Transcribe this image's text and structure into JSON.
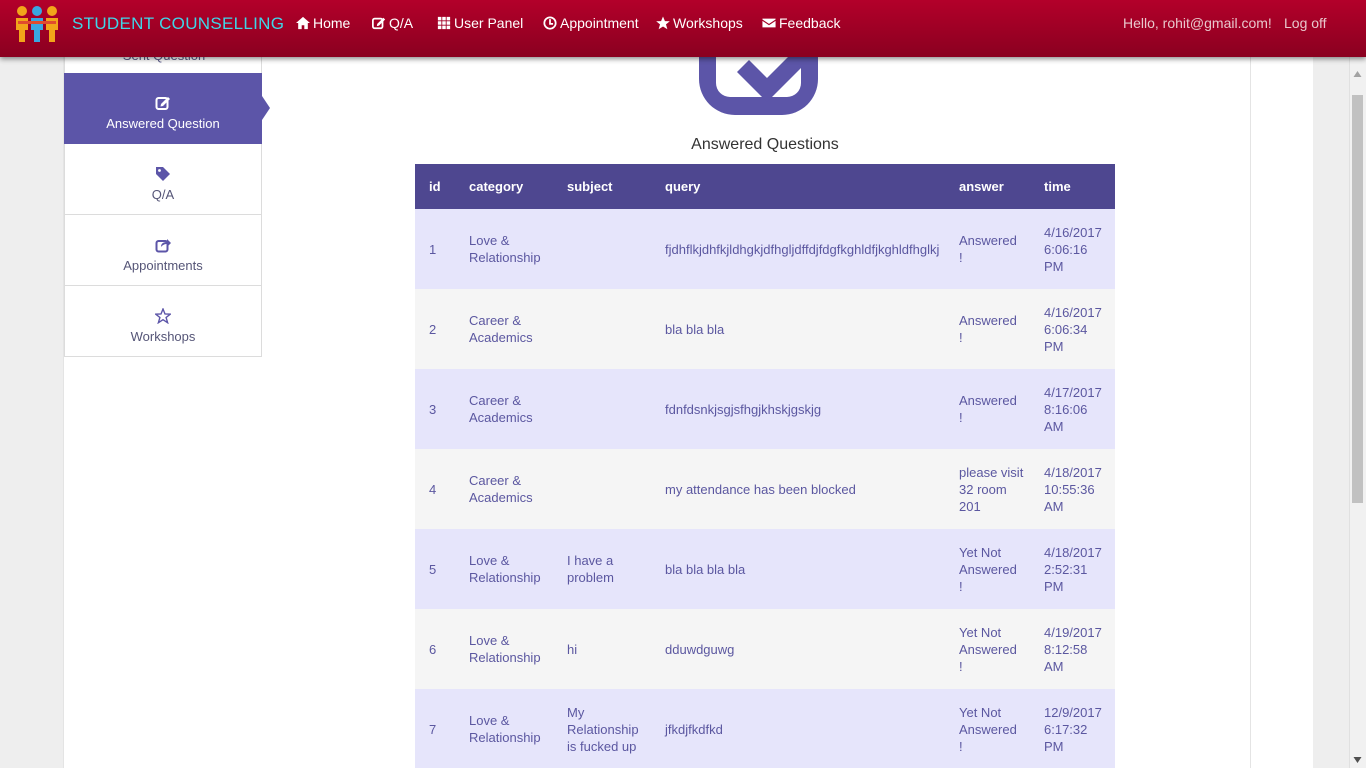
{
  "brand": {
    "title": "STUDENT COUNSELLING"
  },
  "nav": {
    "items": [
      {
        "label": "Home",
        "icon": "home-icon"
      },
      {
        "label": "Q/A",
        "icon": "edit-icon"
      },
      {
        "label": "User Panel",
        "icon": "grid-icon"
      },
      {
        "label": "Appointment",
        "icon": "clock-icon"
      },
      {
        "label": "Workshops",
        "icon": "star-icon"
      },
      {
        "label": "Feedback",
        "icon": "envelope-icon"
      }
    ],
    "greeting": "Hello, rohit@gmail.com!",
    "logoff": "Log off"
  },
  "sidebar": {
    "partial_label": "Sent Question",
    "items": [
      {
        "label": "Answered Question",
        "icon": "edit-icon",
        "active": true
      },
      {
        "label": "Q/A",
        "icon": "tag-icon"
      },
      {
        "label": "Appointments",
        "icon": "share-icon"
      },
      {
        "label": "Workshops",
        "icon": "star-outline-icon"
      }
    ]
  },
  "main": {
    "title": "Answered Questions",
    "columns": [
      "id",
      "category",
      "subject",
      "query",
      "answer",
      "time"
    ],
    "rows": [
      {
        "id": "1",
        "category": "Love & Relationship",
        "subject": "",
        "query": "fjdhflkjdhfkjldhgkjdfhgljdffdjfdgfkghldfjkghldfhglkj",
        "answer": "Answered !",
        "time": "4/16/2017 6:06:16 PM"
      },
      {
        "id": "2",
        "category": "Career & Academics",
        "subject": "",
        "query": "bla bla bla",
        "answer": "Answered !",
        "time": "4/16/2017 6:06:34 PM"
      },
      {
        "id": "3",
        "category": "Career & Academics",
        "subject": "",
        "query": "fdnfdsnkjsgjsfhgjkhskjgskjg",
        "answer": "Answered !",
        "time": "4/17/2017 8:16:06 AM"
      },
      {
        "id": "4",
        "category": "Career & Academics",
        "subject": "",
        "query": "my attendance has been blocked",
        "answer": "please visit 32 room 201",
        "time": "4/18/2017 10:55:36 AM"
      },
      {
        "id": "5",
        "category": "Love & Relationship",
        "subject": "I have a problem",
        "query": "bla bla bla bla",
        "answer": "Yet Not Answered !",
        "time": "4/18/2017 2:52:31 PM"
      },
      {
        "id": "6",
        "category": "Love & Relationship",
        "subject": "hi",
        "query": "dduwdguwg",
        "answer": "Yet Not Answered !",
        "time": "4/19/2017 8:12:58 AM"
      },
      {
        "id": "7",
        "category": "Love & Relationship",
        "subject": "My Relationship is fucked up",
        "query": "jfkdjfkdfkd",
        "answer": "Yet Not Answered !",
        "time": "12/9/2017 6:17:32 PM"
      }
    ]
  },
  "colors": {
    "navbar": "#a00025",
    "brand_text": "#3fd6e8",
    "accent": "#5c55a8",
    "table_header": "#4e4790"
  }
}
